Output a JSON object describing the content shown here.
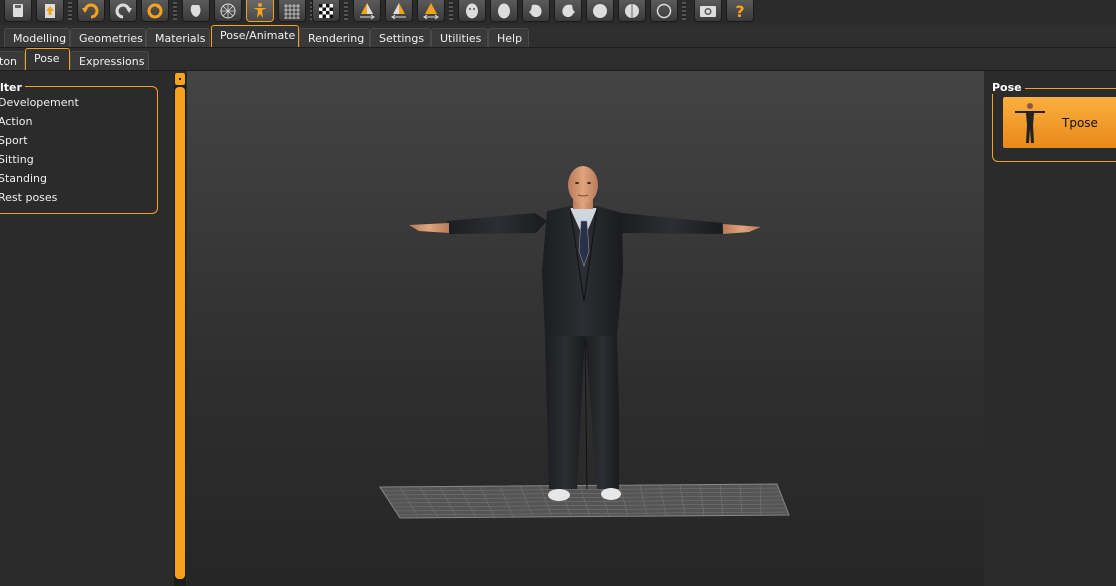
{
  "toolbar": {
    "buttons": [
      "save-icon",
      "export-icon",
      "undo-icon",
      "redo-icon",
      "reset-icon",
      "smooth-icon",
      "wireframe-icon",
      "pose-icon",
      "grid-icon",
      "checker-icon",
      "symmetry-right-icon",
      "symmetry-left-icon",
      "symmetry-icon",
      "front-view-icon",
      "back-view-icon",
      "left-view-icon",
      "right-view-icon",
      "top-view-icon",
      "bottom-view-icon",
      "reset-camera-icon",
      "screenshot-icon",
      "help-icon"
    ]
  },
  "menu": {
    "tabs": [
      "Modelling",
      "Geometries",
      "Materials",
      "Pose/Animate",
      "Rendering",
      "Settings",
      "Utilities",
      "Help"
    ],
    "active": "Pose/Animate"
  },
  "subtabs": {
    "tabs": [
      "ton",
      "Pose",
      "Expressions"
    ],
    "active": "Pose"
  },
  "filter": {
    "title": "lter",
    "items": [
      "Developement",
      "Action",
      "Sport",
      "Sitting",
      "Standing",
      "Rest poses"
    ]
  },
  "pose_panel": {
    "title": "Pose",
    "selected": "Tpose"
  },
  "colors": {
    "accent": "#f7a21b",
    "background": "#2b2b2b"
  }
}
